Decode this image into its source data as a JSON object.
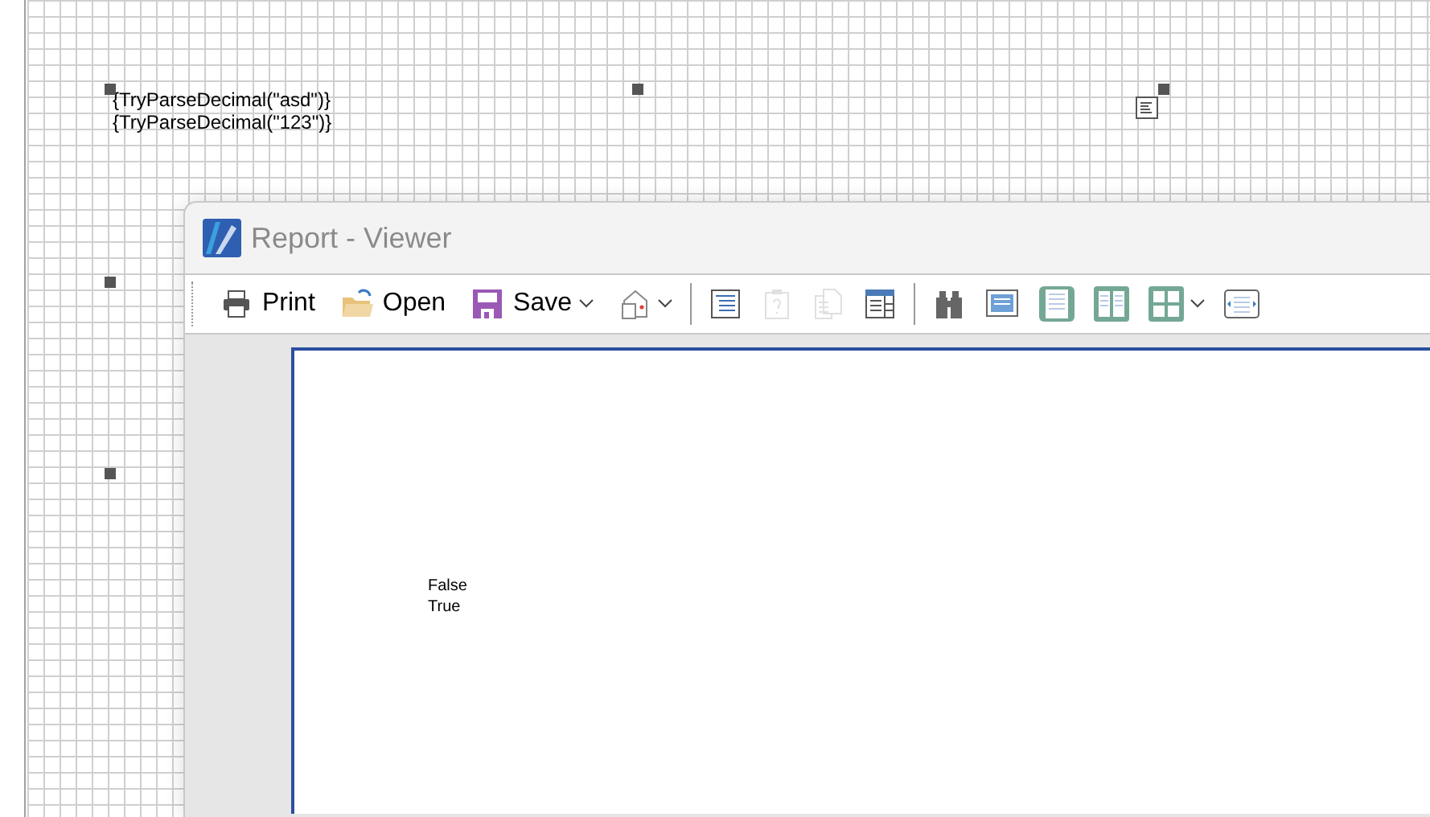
{
  "designer": {
    "expressions": [
      "{TryParseDecimal(\"asd\")}",
      "{TryParseDecimal(\"123\")}"
    ]
  },
  "viewer": {
    "title": "Report - Viewer",
    "toolbar": [
      {
        "kind": "print",
        "label": "Print",
        "disabled": false,
        "dropdown": false
      },
      {
        "kind": "open",
        "label": "Open",
        "disabled": false,
        "dropdown": false
      },
      {
        "kind": "save",
        "label": "Save",
        "disabled": false,
        "dropdown": true
      },
      {
        "kind": "send",
        "disabled": false,
        "dropdown": true
      },
      {
        "kind": "separator"
      },
      {
        "kind": "outline",
        "disabled": false,
        "dropdown": false
      },
      {
        "kind": "paste",
        "disabled": true,
        "dropdown": false
      },
      {
        "kind": "copy",
        "disabled": true,
        "dropdown": false
      },
      {
        "kind": "table",
        "disabled": false,
        "dropdown": false
      },
      {
        "kind": "separator"
      },
      {
        "kind": "find",
        "disabled": false,
        "dropdown": false
      },
      {
        "kind": "single",
        "disabled": false,
        "dropdown": false
      },
      {
        "kind": "page",
        "disabled": false,
        "dropdown": false
      },
      {
        "kind": "two",
        "disabled": false,
        "dropdown": false
      },
      {
        "kind": "multi",
        "disabled": false,
        "dropdown": true
      },
      {
        "kind": "width",
        "disabled": false,
        "dropdown": false
      }
    ],
    "page": {
      "lines": [
        "False",
        "True"
      ]
    }
  }
}
